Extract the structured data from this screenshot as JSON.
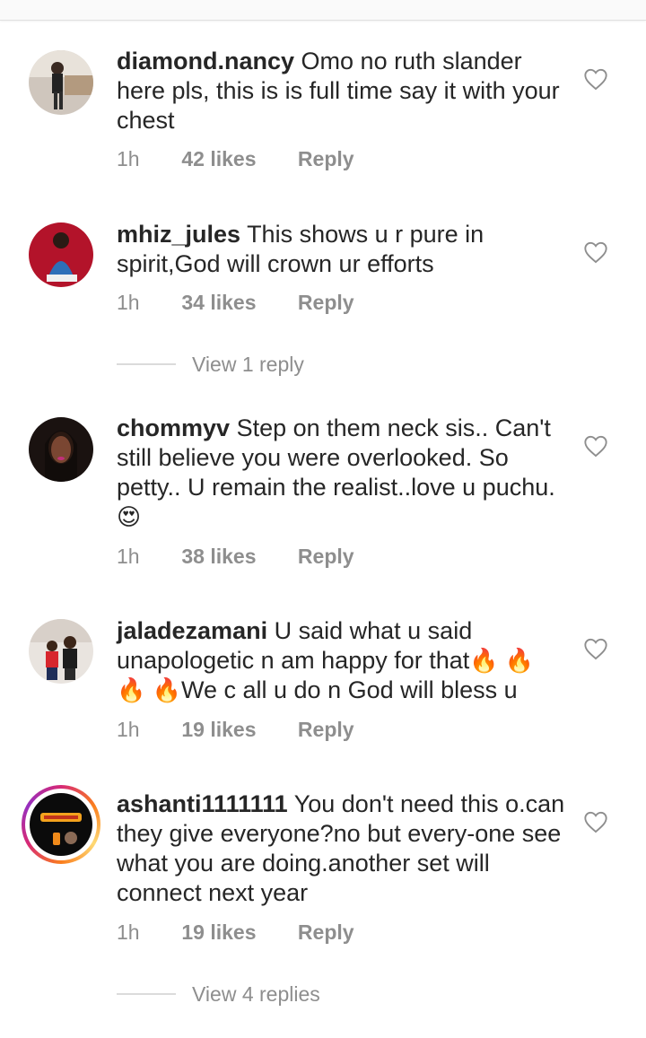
{
  "comments": [
    {
      "username": "diamond.nancy",
      "text": "Omo no ruth slander here pls, this is is full time say it with your chest",
      "time": "1h",
      "likes": "42 likes",
      "reply": "Reply"
    },
    {
      "username": "mhiz_jules",
      "text": "This shows u r pure in spirit,God will crown ur efforts",
      "time": "1h",
      "likes": "34 likes",
      "reply": "Reply",
      "view_replies": "View 1 reply"
    },
    {
      "username": "chommyv",
      "text": "Step on them neck sis.. Can't still believe you were overlooked. So petty.. U remain the realist..love u puchu.",
      "emoji": "😍",
      "time": "1h",
      "likes": "38 likes",
      "reply": "Reply"
    },
    {
      "username": "jaladezamani",
      "text_a": "U said what u said unapologetic n am happy for that",
      "emoji_a": "🔥 🔥",
      "emoji_b": "🔥 🔥",
      "text_b": "We c all u do n God will bless u",
      "time": "1h",
      "likes": "19 likes",
      "reply": "Reply"
    },
    {
      "username": "ashanti1111111",
      "text": "You don't need this o.can they  give everyone?no but every-one see what you are doing.another set will connect next year",
      "time": "1h",
      "likes": "19 likes",
      "reply": "Reply",
      "view_replies": "View 4 replies"
    }
  ],
  "icons": {
    "like": "heart-outline-icon"
  },
  "colors": {
    "text": "#262626",
    "secondary": "#8e8e8e",
    "story_ring_start": "#d62976",
    "story_ring_end": "#fa7e1e"
  }
}
